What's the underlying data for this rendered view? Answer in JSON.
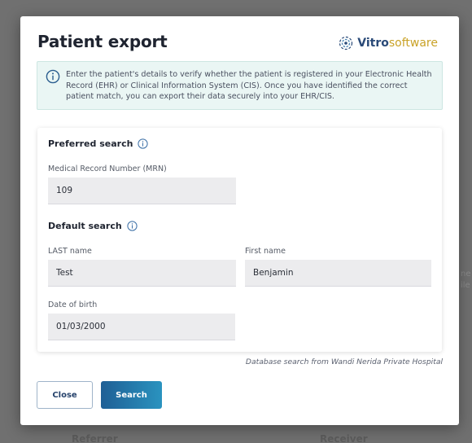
{
  "background": {
    "bottom_labels": [
      "Referrer",
      "Receiver"
    ],
    "side_fragments": [
      "ne",
      "ile"
    ]
  },
  "modal": {
    "title": "Patient export",
    "logo": {
      "part1": "Vitro",
      "part2": "software",
      "icon": "vitro-swirl-icon"
    },
    "info": {
      "icon": "info-circle-icon",
      "text": "Enter the patient's details to verify whether the patient is registered in your Electronic Health Record (EHR) or Clinical Information System (CIS). Once you have identified the correct patient match, you can export their data securely into your EHR/CIS."
    },
    "preferred": {
      "title": "Preferred search",
      "mrn_label": "Medical Record Number (MRN)",
      "mrn_value": "109"
    },
    "default": {
      "title": "Default search",
      "last_label": "LAST name",
      "last_value": "Test",
      "first_label": "First name",
      "first_value": "Benjamin",
      "dob_label": "Date of birth",
      "dob_value": "01/03/2000"
    },
    "db_note": "Database search from Wandi Nerida Private Hospital",
    "buttons": {
      "close": "Close",
      "search": "Search"
    }
  },
  "colors": {
    "accent": "#2a5d8f",
    "info_bg": "#eaf6f4",
    "logo_gold": "#c9a227",
    "button_gradient": [
      "#1f5f95",
      "#2a93bf"
    ]
  }
}
